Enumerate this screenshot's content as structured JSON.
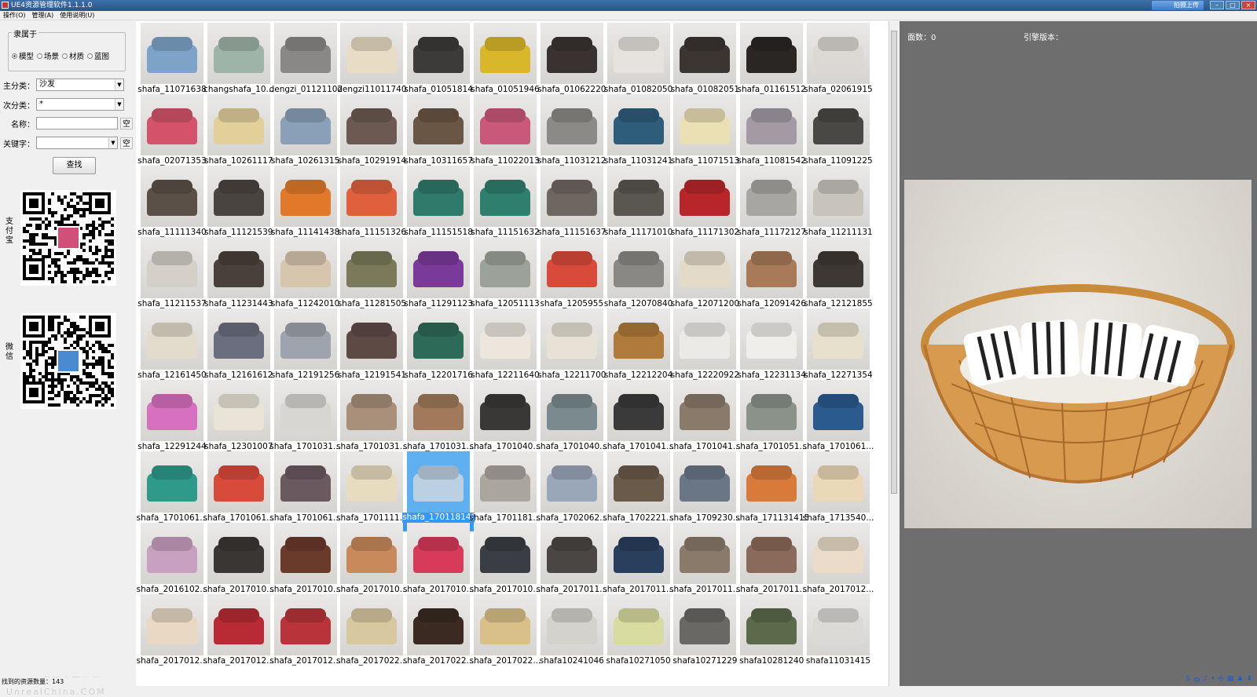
{
  "titlebar": {
    "title": "UE4资源管理软件1.1.1.0",
    "upload_label": "拍摄上传"
  },
  "menu": [
    "操作(O)",
    "管理(A)",
    "使用说明(U)"
  ],
  "filters": {
    "group_title": "隶属于",
    "radios": [
      {
        "label": "模型",
        "checked": true
      },
      {
        "label": "场景",
        "checked": false
      },
      {
        "label": "材质",
        "checked": false
      },
      {
        "label": "蓝图",
        "checked": false
      }
    ],
    "main_label": "主分类：",
    "main_value": "沙发",
    "sub_label": "次分类：",
    "sub_value": "*",
    "name_label": "名称：",
    "name_clear": "空",
    "keyword_label": "关键字：",
    "keyword_clear": "空",
    "search_button": "查找",
    "alipay_label": "支付宝",
    "wechat_label": "微信"
  },
  "grid": {
    "rows": [
      [
        "shafa_11071638",
        "changshafa_10...",
        "dengzi_01121102",
        "dengzi11011740",
        "shafa_01051814",
        "shafa_01051946",
        "shafa_01062220",
        "shafa_01082050",
        "shafa_01082051",
        "shafa_01161512",
        "shafa_02061915"
      ],
      [
        "shafa_02071353",
        "shafa_10261117",
        "shafa_10261315",
        "shafa_10291914",
        "shafa_10311657",
        "shafa_11022013",
        "shafa_11031212",
        "shafa_11031241",
        "shafa_11071513",
        "shafa_11081542",
        "shafa_11091225"
      ],
      [
        "shafa_11111340",
        "shafa_11121539",
        "shafa_11141438",
        "shafa_11151326",
        "shafa_11151518",
        "shafa_11151632",
        "shafa_11151637",
        "shafa_11171010",
        "shafa_11171302",
        "shafa_11172127",
        "shafa_11211131"
      ],
      [
        "shafa_11211537",
        "shafa_11231443",
        "shafa_11242010",
        "shafa_11281505",
        "shafa_11291123",
        "shafa_12051113",
        "shafa_1205955",
        "shafa_12070840",
        "shafa_12071200",
        "shafa_12091426",
        "shafa_12121855"
      ],
      [
        "shafa_12161450",
        "shafa_12161612",
        "shafa_12191256",
        "shafa_12191541",
        "shafa_12201716",
        "shafa_12211640",
        "shafa_12211700",
        "shafa_12212204",
        "shafa_12220922",
        "shafa_12231134",
        "shafa_12271354"
      ],
      [
        "shafa_12291244",
        "shafa_12301007",
        "shafa_1701031...",
        "shafa_1701031...",
        "shafa_1701031...",
        "shafa_1701040...",
        "shafa_1701040...",
        "shafa_1701041...",
        "shafa_1701041...",
        "shafa_1701051...",
        "shafa_1701061..."
      ],
      [
        "shafa_1701061...",
        "shafa_1701061...",
        "shafa_1701061...",
        "shafa_1701111...",
        "shafa_1701181406",
        "shafa_1701181...",
        "shafa_1702062...",
        "shafa_1702221...",
        "shafa_1709230...",
        "shafa_171131415",
        "shafa_1713540..."
      ],
      [
        "shafa_2016102...",
        "shafa_2017010...",
        "shafa_2017010...",
        "shafa_2017010...",
        "shafa_2017010...",
        "shafa_2017010...",
        "shafa_2017011...",
        "shafa_2017011...",
        "shafa_2017011...",
        "shafa_2017011...",
        "shafa_2017012..."
      ],
      [
        "shafa_2017012...",
        "shafa_2017012...",
        "shafa_2017012...",
        "shafa_2017022...",
        "shafa_2017022...",
        "shafa_2017022...",
        "shafa10241046",
        "shafa10271050",
        "shafa10271229",
        "shafa10281240",
        "shafa11031415"
      ]
    ],
    "colors": [
      [
        "#7ea3c8",
        "#9fb4a8",
        "#8a8886",
        "#e8dcc4",
        "#3c3b3a",
        "#d8b82a",
        "#3a3230",
        "#e6e3de",
        "#3b3532",
        "#2a2624",
        "#dcd9d4"
      ],
      [
        "#d4536a",
        "#e2cf9a",
        "#8aa0b8",
        "#6c5a52",
        "#6a5644",
        "#c9587a",
        "#8c8a86",
        "#2e5d7c",
        "#eae0b4",
        "#a49aa4",
        "#4a4844"
      ],
      [
        "#5a5048",
        "#4a4440",
        "#e07a2a",
        "#e0603e",
        "#2f7a6a",
        "#2e7f6c",
        "#6e6660",
        "#5a5650",
        "#b8262a",
        "#a8a6a2",
        "#c8c4bc"
      ],
      [
        "#d4d0c8",
        "#4a403a",
        "#d6c6ae",
        "#7a7a5a",
        "#7a3a9a",
        "#9ca29a",
        "#d84a3a",
        "#8a8884",
        "#e4dac8",
        "#a87a5a",
        "#3e3834"
      ],
      [
        "#e2dccc",
        "#6a6e7e",
        "#9ea4ae",
        "#5e4a44",
        "#2e6a58",
        "#ece6dc",
        "#e8e2d6",
        "#b07a3a",
        "#eceae6",
        "#f0eeea",
        "#e6e0cc"
      ],
      [
        "#d870c0",
        "#eae4d8",
        "#d8d6d2",
        "#a8907a",
        "#a07a5a",
        "#3a3836",
        "#7a8a8e",
        "#3a3a3a",
        "#8a7a6a",
        "#8a928a",
        "#2a5a8e"
      ],
      [
        "#2e9a8a",
        "#d84a3a",
        "#6a5a60",
        "#e8dcc0",
        "#bcd0e4",
        "#aaa69e",
        "#9aa6ba",
        "#6a5a4a",
        "#6a7686",
        "#d87a3a",
        "#ead8b8"
      ],
      [
        "#c8a0c0",
        "#3a3634",
        "#6a3a2a",
        "#c88a5a",
        "#d83a5a",
        "#3a3e44",
        "#4a4644",
        "#2a3e5e",
        "#8a7a6a",
        "#8a6a5a",
        "#eadcc8"
      ],
      [
        "#e8d8c4",
        "#b82a34",
        "#b8343a",
        "#d8c8a0",
        "#3a2a22",
        "#d8c088",
        "#d4d2cc",
        "#d8dca0",
        "#6a6864",
        "#5a6a4a",
        "#dcdad6"
      ]
    ],
    "selected": {
      "row": 6,
      "col": 4,
      "caption": "shafa_1701181406"
    }
  },
  "right": {
    "faces_label": "面数：0",
    "engine_label": "引擎版本："
  },
  "status": {
    "label": "找到的资源数量：143"
  },
  "watermark": "UECN 虚幻中国社区 UnrealChina.COM",
  "tray": [
    "S",
    "中",
    "♪",
    "•",
    "⎆",
    "▦",
    "♟",
    "⬍"
  ]
}
